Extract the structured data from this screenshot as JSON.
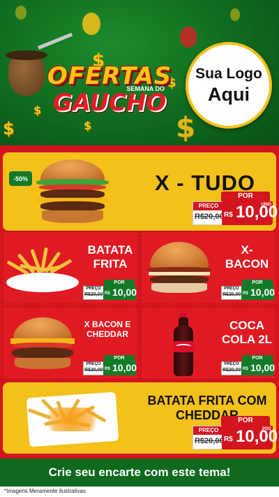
{
  "header": {
    "title_line1": "OFERTAS",
    "title_small": "SEMANA DO",
    "title_line2": "GAUCHO",
    "logo_line1": "Sua Logo",
    "logo_line2": "Aqui"
  },
  "colors": {
    "green": "#0f6a1e",
    "red": "#d2151f",
    "yellow": "#f4c11b"
  },
  "products": {
    "xtudo": {
      "badge": "-50%",
      "name": "X - TUDO",
      "por": "POR",
      "preco_label": "PREÇO",
      "old_price": "R$20,00",
      "currency": "R$",
      "price": "10,00",
      "unit": "UNID"
    },
    "batata": {
      "name_line1": "BATATA",
      "name_line2": "FRITA",
      "por": "POR",
      "preco_label": "PREÇO",
      "old_price": "R$20,00",
      "currency": "R$",
      "price": "10,00"
    },
    "xbacon": {
      "name_line1": "X-",
      "name_line2": "BACON",
      "por": "POR",
      "preco_label": "PREÇO",
      "old_price": "R$20,00",
      "currency": "R$",
      "price": "10,00"
    },
    "xbaconcheddar": {
      "name_line1": "X BACON E",
      "name_line2": "CHEDDAR",
      "por": "POR",
      "preco_label": "PREÇO",
      "old_price": "R$20,00",
      "currency": "R$",
      "price": "10,00"
    },
    "coca": {
      "name_line1": "COCA",
      "name_line2": "COLA 2L",
      "por": "POR",
      "preco_label": "PREÇO",
      "old_price": "R$20,00",
      "currency": "R$",
      "price": "10,00"
    },
    "batatacheddar": {
      "name_line1": "BATATA FRITA COM",
      "name_line2": "CHEDDAR",
      "por": "POR",
      "preco_label": "PREÇO",
      "old_price": "R$20,00",
      "currency": "R$",
      "price": "10,00",
      "unit": "POÇ"
    }
  },
  "footer": {
    "cta": "Crie seu encarte com este tema!",
    "disclaimer": "*Imagens Meramente Ilustrativas"
  }
}
